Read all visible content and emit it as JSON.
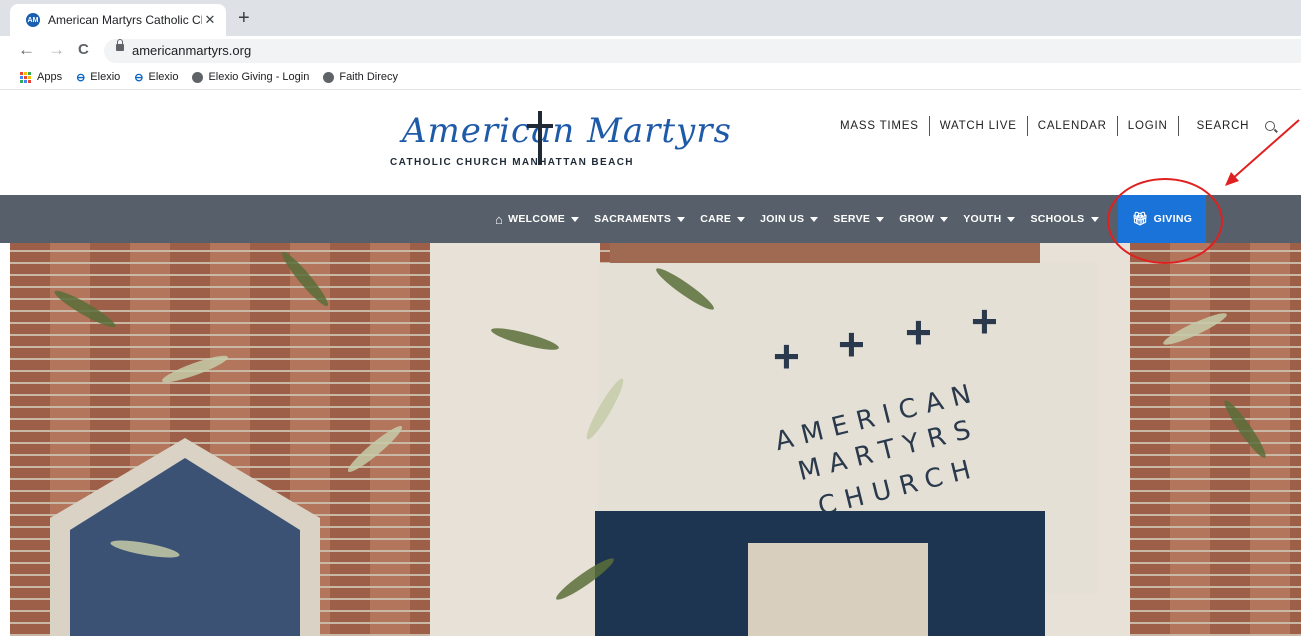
{
  "browser": {
    "tab_title": "American Martyrs Catholic Churc",
    "tab_close": "✕",
    "new_tab": "+",
    "url": "americanmartyrs.org",
    "nav": {
      "back": "←",
      "forward": "→",
      "reload": "C"
    },
    "bookmarks": [
      {
        "label": "Apps",
        "icon": "apps-grid-icon"
      },
      {
        "label": "Elexio",
        "icon": "elexio-icon"
      },
      {
        "label": "Elexio",
        "icon": "elexio-icon"
      },
      {
        "label": "Elexio Giving - Login",
        "icon": "globe-icon"
      },
      {
        "label": "Faith Direcy",
        "icon": "globe-icon"
      }
    ]
  },
  "site": {
    "logo": {
      "script": "American Martyrs",
      "subtitle": "CATHOLIC CHURCH MANHATTAN BEACH"
    },
    "utility_links": [
      "MASS TIMES",
      "WATCH LIVE",
      "CALENDAR",
      "LOGIN",
      "SEARCH"
    ],
    "nav_items": [
      "WELCOME",
      "SACRAMENTS",
      "CARE",
      "JOIN US",
      "SERVE",
      "GROW",
      "YOUTH",
      "SCHOOLS"
    ],
    "giving_label": "GIVING",
    "hero": {
      "crosses": [
        "+",
        "+",
        "+",
        "+"
      ],
      "sign_lines": [
        "AMERICAN",
        "MARTYRS",
        "CHURCH"
      ]
    }
  },
  "colors": {
    "nav_bg": "#57606a",
    "giving_bg": "#1a73d9",
    "annotation": "#e02020",
    "logo_blue": "#1e5aa8"
  }
}
